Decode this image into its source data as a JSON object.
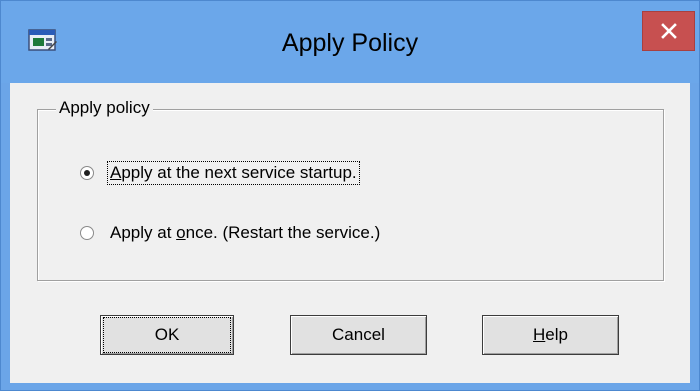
{
  "window": {
    "title": "Apply Policy",
    "close_icon": "close-icon",
    "app_icon": "app-window-icon"
  },
  "group": {
    "legend": "Apply policy",
    "options": [
      {
        "label_pre": "",
        "mnemonic": "A",
        "label_post": "pply at the next service startup.",
        "checked": true
      },
      {
        "label_pre": "Apply at ",
        "mnemonic": "o",
        "label_post": "nce. (Restart the service.)",
        "checked": false
      }
    ]
  },
  "buttons": {
    "ok_label": "OK",
    "cancel_label": "Cancel",
    "help_mnemonic": "H",
    "help_rest": "elp"
  }
}
